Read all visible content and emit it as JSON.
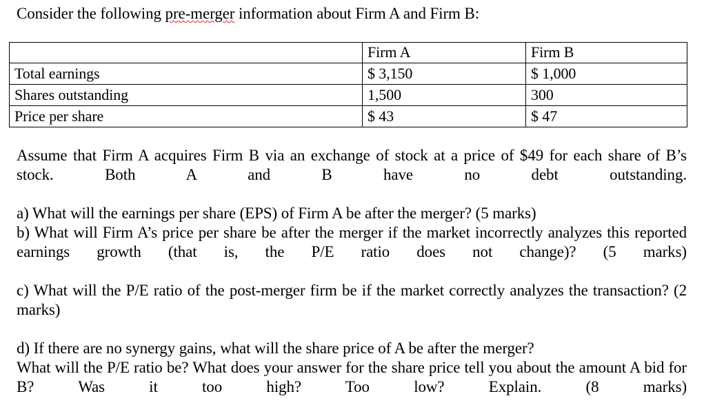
{
  "document": {
    "intro": {
      "before": "Consider the following ",
      "misspelled": "pre-merger",
      "after": " information about Firm A and Firm B:"
    },
    "table": {
      "headers": [
        "",
        "Firm A",
        "Firm B"
      ],
      "rows": [
        {
          "label": "Total earnings",
          "firm_a": "$ 3,150",
          "firm_b": "$ 1,000"
        },
        {
          "label": "Shares outstanding",
          "firm_a": "1,500",
          "firm_b": "300"
        },
        {
          "label": "Price per share",
          "firm_a": "$ 43",
          "firm_b": "$ 47"
        }
      ]
    },
    "assumption": "Assume that Firm A acquires Firm B via an exchange of stock at a price of $49 for each share of B’s stock. Both A and B have no debt outstanding.",
    "questions": [
      "a) What will the earnings per share (EPS) of Firm A be after the merger? (5 marks)",
      "b) What will Firm A’s price per share be after the merger if the market incorrectly analyzes this reported earnings growth (that is, the P/E ratio does not change)? (5 marks)",
      "c) What will the P/E ratio of the post-merger firm be if the market correctly analyzes the transaction? (2 marks)",
      "d) If there are no synergy gains, what will the share price of A be after the merger?",
      "What will the P/E ratio be? What does your answer for the share price tell you about the amount A bid for B? Was it too high? Too low? Explain. (8 marks)"
    ],
    "colors": {
      "text": "#000000",
      "background": "#ffffff",
      "spellcheck_underline": "#d42a2a",
      "table_border": "#000000"
    }
  }
}
